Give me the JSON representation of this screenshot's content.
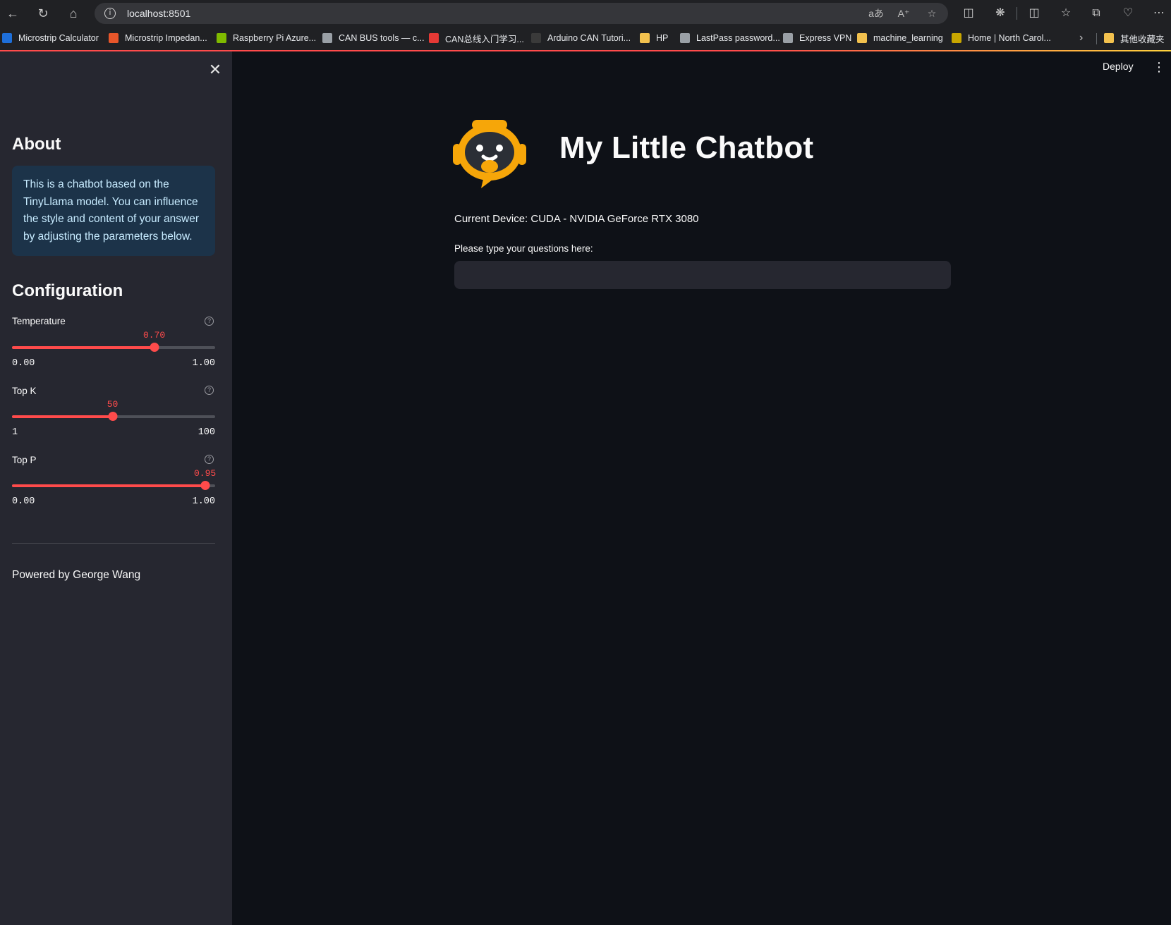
{
  "browser": {
    "url": "localhost:8501",
    "bookmarks": [
      {
        "label": "Microstrip Calculator",
        "color": "#1e6fd9"
      },
      {
        "label": "Microstrip Impedan...",
        "color": "#e8562a"
      },
      {
        "label": "Raspberry Pi Azure...",
        "color": "#7fba00"
      },
      {
        "label": "CAN BUS tools — c...",
        "color": "#9aa0a6"
      },
      {
        "label": "CAN总线入门学习...",
        "color": "#e53935"
      },
      {
        "label": "Arduino CAN Tutori...",
        "color": "#3a3a3a"
      },
      {
        "label": "HP",
        "color": "#f2c14e"
      },
      {
        "label": "LastPass password...",
        "color": "#9aa0a6"
      },
      {
        "label": "Express VPN",
        "color": "#9aa0a6"
      },
      {
        "label": "machine_learning",
        "color": "#f2c14e"
      },
      {
        "label": "Home | North Carol...",
        "color": "#c8a600"
      },
      {
        "label": "其他收藏夹",
        "color": "#f2c14e"
      }
    ]
  },
  "sidebar": {
    "about_heading": "About",
    "about_text": "This is a chatbot based on the TinyLlama model. You can influence the style and content of your answer by adjusting the parameters below.",
    "config_heading": "Configuration",
    "sliders": [
      {
        "label": "Temperature",
        "value": "0.70",
        "min": "0.00",
        "max": "1.00",
        "fraction": 0.7
      },
      {
        "label": "Top K",
        "value": "50",
        "min": "1",
        "max": "100",
        "fraction": 0.495
      },
      {
        "label": "Top P",
        "value": "0.95",
        "min": "0.00",
        "max": "1.00",
        "fraction": 0.95
      }
    ],
    "footer": "Powered by George Wang"
  },
  "main": {
    "deploy_label": "Deploy",
    "title": "My Little Chatbot",
    "device_text": "Current Device: CUDA - NVIDIA GeForce RTX 3080",
    "question_label": "Please type your questions here:",
    "question_value": ""
  },
  "colors": {
    "accent": "#ff4b4b",
    "sidebar_bg": "#262730",
    "main_bg": "#0e1117",
    "info_box_bg": "#1c3349",
    "logo_orange": "#f6a609"
  }
}
